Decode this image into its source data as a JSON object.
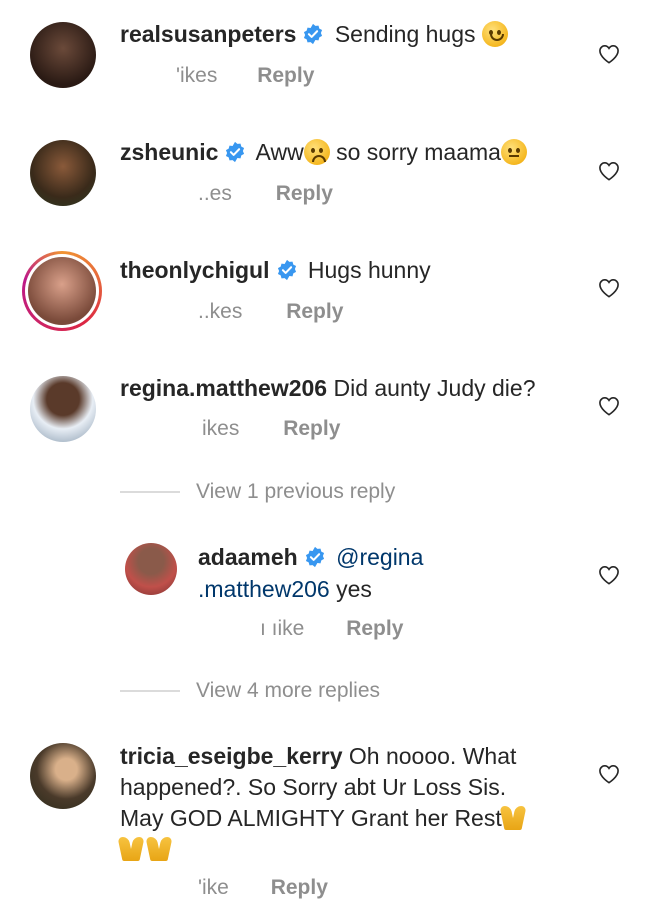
{
  "comments": [
    {
      "username": "realsusanpeters",
      "verified": true,
      "text": "Sending hugs",
      "emoji": "hugging-face-emoji",
      "likes": "'ikes",
      "reply": "Reply"
    },
    {
      "username": "zsheunic",
      "verified": true,
      "text_a": "Aww",
      "emoji_a": "sad-face-emoji",
      "text_b": " so sorry maama",
      "emoji_b": "pensive-face-emoji",
      "likes": "..es",
      "reply": "Reply"
    },
    {
      "username": "theonlychigul",
      "verified": true,
      "text": "Hugs hunny",
      "likes": "..kes",
      "reply": "Reply"
    },
    {
      "username": "regina.matthew206",
      "verified": false,
      "text": "Did aunty Judy die?",
      "likes": "ikes",
      "reply": "Reply"
    }
  ],
  "view_previous": "View 1 previous reply",
  "reply": {
    "username": "adaameh",
    "verified": true,
    "mention_a": "@regina",
    "mention_b": ".matthew206",
    "text": " yes",
    "likes": "ı ıike",
    "reply_label": "Reply"
  },
  "view_more": "View 4 more replies",
  "last_comment": {
    "username": "tricia_eseigbe_kerry",
    "line1": " Oh noooo. What",
    "line2": "happened?. So  Sorry abt Ur Loss Sis.",
    "line3": "May GOD ALMIGHTY Grant her Rest",
    "emoji": "folded-hands-emoji",
    "likes": "'ike",
    "reply": "Reply"
  },
  "colors": {
    "text": "#262626",
    "muted": "#8e8e8e",
    "verified": "#3897f0",
    "mention": "#00376b"
  }
}
